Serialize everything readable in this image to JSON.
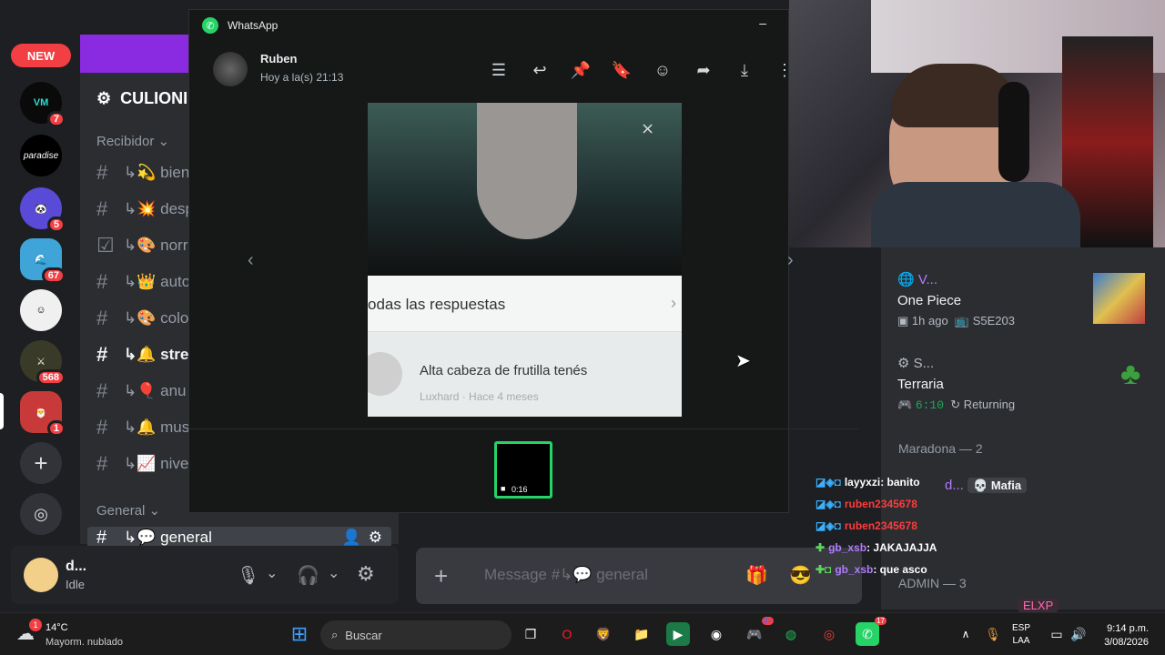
{
  "rail": {
    "new_badge": "NEW",
    "badges": [
      "7",
      "5",
      "67",
      "568",
      "1"
    ],
    "paradise": "paradise"
  },
  "server": {
    "name": "CULIONI",
    "categories": [
      "Recibidor",
      "General"
    ],
    "channels": [
      {
        "label": "↳💫 bien",
        "icon": "hash"
      },
      {
        "label": "↳💥 desp",
        "icon": "hash"
      },
      {
        "label": "↳🎨 norr",
        "icon": "checkbox"
      },
      {
        "label": "↳👑 auto",
        "icon": "hash"
      },
      {
        "label": "↳🎨 colo",
        "icon": "hash"
      },
      {
        "label": "↳🔔 stre",
        "icon": "hash"
      },
      {
        "label": "↳🎈 anu",
        "icon": "hash"
      },
      {
        "label": "↳🔔 mus",
        "icon": "hash"
      },
      {
        "label": "↳📈 nive",
        "icon": "hash"
      },
      {
        "label": "↳💬 general",
        "icon": "hash"
      }
    ]
  },
  "user": {
    "name": "d...",
    "status": "Idle"
  },
  "whatsapp": {
    "title": "WhatsApp",
    "minimize": "–",
    "contact": "Ruben",
    "time": "Hoy a la(s) 21:13",
    "media": {
      "comments_header": "odas las respuestas",
      "comment_text": "Alta cabeza de frutilla tenés",
      "comment_meta": "Luxhard · Hace 4 meses"
    },
    "thumb_duration": "0:16"
  },
  "message_bar": {
    "placeholder": "Message #↳💬 general"
  },
  "members": [
    {
      "name": "V...",
      "game": "One Piece",
      "meta1": "1h ago",
      "meta2": "S5E203"
    },
    {
      "name": "S...",
      "game": "Terraria",
      "meta1": "6:10",
      "meta2": "Returning"
    }
  ],
  "member_groups": [
    "Maradona — 2",
    "ADMIN — 3"
  ],
  "member_extra": {
    "name": "d...",
    "tag": "Mafia",
    "last": "ELXP"
  },
  "chat": [
    {
      "user": "layyxzi",
      "text": ": banito",
      "color": "#ffffff"
    },
    {
      "user": "ruben2345678",
      "text": "",
      "color": "#ff3b3b"
    },
    {
      "user": "ruben2345678",
      "text": "",
      "color": "#ff3b3b"
    },
    {
      "user": "gb_xsb",
      "text": ": JAKAJAJJA",
      "color": "#b07cff"
    },
    {
      "user": "gb_xsb",
      "text": ": que asco",
      "color": "#b07cff"
    }
  ],
  "taskbar": {
    "weather_temp": "14°C",
    "weather_desc": "Mayorm. nublado",
    "weather_badge": "1",
    "search": "Buscar",
    "lang1": "ESP",
    "lang2": "LAA",
    "clock_time": "9:14 p.m.",
    "clock_date": "3/08/2026",
    "wa_badge": "17",
    "discord_badge": "9+"
  },
  "colors": {
    "whatsapp_green": "#25d366",
    "discord_red": "#f23f43",
    "accent_purple": "#8a2be2"
  }
}
